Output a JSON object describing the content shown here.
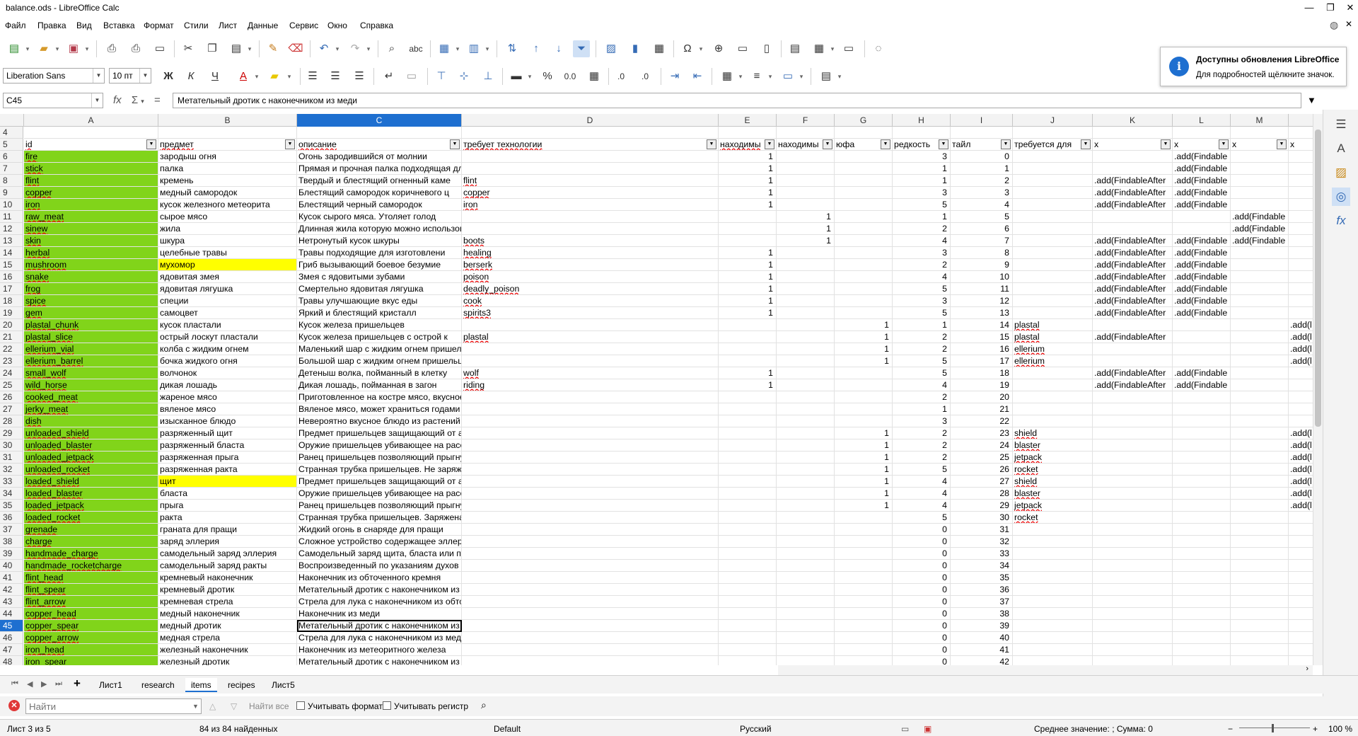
{
  "window": {
    "title": "balance.ods - LibreOffice Calc"
  },
  "menu": [
    "Файл",
    "Правка",
    "Вид",
    "Вставка",
    "Формат",
    "Стили",
    "Лист",
    "Данные",
    "Сервис",
    "Окно",
    "Справка"
  ],
  "toolbar2": {
    "font_name": "Liberation Sans",
    "font_size": "10 пт"
  },
  "formula": {
    "cell_ref": "C45",
    "content": "Метательный дротик с наконечником из меди"
  },
  "notification": {
    "title": "Доступны обновления LibreOffice",
    "text": "Для подробностей щёлкните значок."
  },
  "columns": [
    "A",
    "B",
    "C",
    "D",
    "E",
    "F",
    "G",
    "H",
    "I",
    "J",
    "K",
    "L",
    "M"
  ],
  "header_row": {
    "row": "5",
    "cells": [
      "id",
      "предмет",
      "описание",
      "требует технологии",
      "находимы",
      "находимы",
      "юфа",
      "редкость",
      "тайл",
      "требуется для",
      "x",
      "x",
      "x",
      "x"
    ]
  },
  "rows": [
    {
      "r": "4",
      "a": "",
      "b": "",
      "c": "",
      "d": "",
      "e": "",
      "f": "",
      "g": "",
      "h": "",
      "i": "",
      "j": "",
      "k": "",
      "l": "",
      "m": "",
      "n": ""
    },
    {
      "r": "6",
      "a": "fire",
      "b": "зародыш огня",
      "c": "Огонь зародившийся от молнии",
      "d": "",
      "e": "1",
      "f": "",
      "g": "",
      "h": "3",
      "i": "0",
      "j": "",
      "k": "",
      "l": ".add(Findable",
      "m": "",
      "n": ""
    },
    {
      "r": "7",
      "a": "stick",
      "b": "палка",
      "c": "Прямая и прочная палка подходящая для копья",
      "d": "",
      "e": "1",
      "f": "",
      "g": "",
      "h": "1",
      "i": "1",
      "j": "",
      "k": "",
      ".l": "",
      "l": ".add(Findable",
      "m": "",
      "n": ""
    },
    {
      "r": "8",
      "a": "flint",
      "b": "кремень",
      "c": "Твердый и блестящий огненный каме",
      "d": "flint",
      "e": "1",
      "f": "",
      "g": "",
      "h": "1",
      "i": "2",
      "j": "",
      "k": ".add(FindableAfter",
      ".l": "",
      "l": ".add(Findable",
      "m": "",
      "n": ""
    },
    {
      "r": "9",
      "a": "copper",
      "b": "медный самородок",
      "c": "Блестящий самородок коричневого ц",
      "d": "copper",
      "e": "1",
      "f": "",
      "g": "",
      "h": "3",
      "i": "3",
      "j": "",
      "k": ".add(FindableAfter",
      "l": ".add(Findable",
      "m": "",
      "n": ""
    },
    {
      "r": "10",
      "a": "iron",
      "b": "кусок железного метеорита",
      "c": "Блестящий черный самородок",
      "d": "iron",
      "e": "1",
      "f": "",
      "g": "",
      "h": "5",
      "i": "4",
      "j": "",
      "k": ".add(FindableAfter",
      "l": ".add(Findable",
      "m": "",
      "n": ""
    },
    {
      "r": "11",
      "a": "raw_meat",
      "b": "сырое мясо",
      "c": "Кусок сырого мяса. Утоляет голод",
      "d": "",
      "e": "",
      "f": "1",
      "g": "",
      "h": "1",
      "i": "5",
      "j": "",
      "k": "",
      "l": "",
      "m": ".add(Findable",
      "n": ""
    },
    {
      "r": "12",
      "a": "sinew",
      "b": "жила",
      "c": "Длинная жила которую можно использовать для создания вещей",
      "d": "",
      "e": "",
      "f": "1",
      "g": "",
      "h": "2",
      "i": "6",
      "j": "",
      "k": "",
      "l": "",
      "m": ".add(Findable",
      "n": ""
    },
    {
      "r": "13",
      "a": "skin",
      "b": "шкура",
      "c": "Нетронутый кусок шкуры",
      "d": "boots",
      "e": "",
      "f": "1",
      "g": "",
      "h": "4",
      "i": "7",
      "j": "",
      "k": ".add(FindableAfter",
      "l": ".add(Findable",
      "m": ".add(Findable",
      "n": ""
    },
    {
      "r": "14",
      "a": "herbal",
      "b": "целебные травы",
      "c": "Травы подходящие для изготовлени",
      "d": "healing",
      "e": "1",
      "f": "",
      "g": "",
      "h": "3",
      "i": "8",
      "j": "",
      "k": ".add(FindableAfter",
      "l": ".add(Findable",
      "m": "",
      "n": ""
    },
    {
      "r": "15",
      "a": "mushroom",
      "b": "мухомор",
      "c": "Гриб вызывающий боевое безумие",
      "d": "berserk",
      "e": "1",
      "f": "",
      "g": "",
      "h": "2",
      "i": "9",
      "j": "",
      "k": ".add(FindableAfter",
      "l": ".add(Findable",
      "m": "",
      "n": ""
    },
    {
      "r": "16",
      "a": "snake",
      "b": "ядовитая змея",
      "c": "Змея с ядовитыми зубами",
      "d": "poison",
      "e": "1",
      "f": "",
      "g": "",
      "h": "4",
      "i": "10",
      "j": "",
      "k": ".add(FindableAfter",
      "l": ".add(Findable",
      "m": "",
      "n": ""
    },
    {
      "r": "17",
      "a": "frog",
      "b": "ядовитая лягушка",
      "c": "Смертельно ядовитая лягушка",
      "d": "deadly_poison",
      "e": "1",
      "f": "",
      "g": "",
      "h": "5",
      "i": "11",
      "j": "",
      "k": ".add(FindableAfter",
      "l": ".add(Findable",
      "m": "",
      "n": ""
    },
    {
      "r": "18",
      "a": "spice",
      "b": "специи",
      "c": "Травы улучшающие вкус еды",
      "d": "cook",
      "e": "1",
      "f": "",
      "g": "",
      "h": "3",
      "i": "12",
      "j": "",
      "k": ".add(FindableAfter",
      "l": ".add(Findable",
      "m": "",
      "n": ""
    },
    {
      "r": "19",
      "a": "gem",
      "b": "самоцвет",
      "c": "Яркий и блестящий кристалл",
      "d": "spirits3",
      "e": "1",
      "f": "",
      "g": "",
      "h": "5",
      "i": "13",
      "j": "",
      "k": ".add(FindableAfter",
      "l": ".add(Findable",
      "m": "",
      "n": ""
    },
    {
      "r": "20",
      "a": "plastal_chunk",
      "b": "кусок пластали",
      "c": "Кусок железа пришельцев",
      "d": "",
      "e": "",
      "f": "",
      "g": "1",
      "h": "1",
      "i": "14",
      "j": "plastal",
      "k": "",
      "l": "",
      "m": "",
      "n": ".add(l"
    },
    {
      "r": "21",
      "a": "plastal_slice",
      "b": "острый лоскут пластали",
      "c": "Кусок железа пришельцев с острой к",
      "d": "plastal",
      "e": "",
      "f": "",
      "g": "1",
      "h": "2",
      "i": "15",
      "j": "plastal",
      "k": ".add(FindableAfter",
      "l": "",
      "m": "",
      "n": ".add(l"
    },
    {
      "r": "22",
      "a": "ellerium_vial",
      "b": "колба с жидким огнем",
      "c": "Маленький шар с жидким огнем пришельцев",
      "d": "",
      "e": "",
      "f": "",
      "g": "1",
      "h": "2",
      "i": "16",
      "j": "ellerium",
      "k": "",
      "l": "",
      "m": "",
      "n": ".add(l"
    },
    {
      "r": "23",
      "a": "ellerium_barrel",
      "b": "бочка жидкого огня",
      "c": "Большой шар с жидким огнем пришельцев. Выглядит опасным.",
      "d": "",
      "e": "",
      "f": "",
      "g": "1",
      "h": "5",
      "i": "17",
      "j": "ellerium",
      "k": "",
      "l": "",
      "m": "",
      "n": ".add(l"
    },
    {
      "r": "24",
      "a": "small_wolf",
      "b": "волчонок",
      "c": "Детеныш волка, пойманный в клетку",
      "d": "wolf",
      "e": "1",
      "f": "",
      "g": "",
      "h": "5",
      "i": "18",
      "j": "",
      "k": ".add(FindableAfter",
      "l": ".add(Findable",
      "m": "",
      "n": ""
    },
    {
      "r": "25",
      "a": "wild_horse",
      "b": "дикая лошадь",
      "c": "Дикая лошадь, пойманная в загон",
      "d": "riding",
      "e": "1",
      "f": "",
      "g": "",
      "h": "4",
      "i": "19",
      "j": "",
      "k": ".add(FindableAfter",
      "l": ".add(Findable",
      "m": "",
      "n": ""
    },
    {
      "r": "26",
      "a": "cooked_meat",
      "b": "жареное мясо",
      "c": "Приготовленное на костре мясо, вкусное и питательное",
      "d": "",
      "e": "",
      "f": "",
      "g": "",
      "h": "2",
      "i": "20",
      "j": "",
      "k": "",
      "l": "",
      "m": "",
      "n": ""
    },
    {
      "r": "27",
      "a": "jerky_meat",
      "b": "вяленое мясо",
      "c": "Вяленое мясо, может храниться годами",
      "d": "",
      "e": "",
      "f": "",
      "g": "",
      "h": "1",
      "i": "21",
      "j": "",
      "k": "",
      "l": "",
      "m": "",
      "n": ""
    },
    {
      "r": "28",
      "a": "dish",
      "b": "изысканное блюдо",
      "c": "Невероятно вкусное блюдо из растений и мяса",
      "d": "",
      "e": "",
      "f": "",
      "g": "",
      "h": "3",
      "i": "22",
      "j": "",
      "k": "",
      "l": "",
      "m": "",
      "n": ""
    },
    {
      "r": "29",
      "a": "unloaded_shield",
      "b": "разряженный щит",
      "c": "Предмет пришельцев защищающий от атак. Этот выглядит разряженным",
      "d": "",
      "e": "",
      "f": "",
      "g": "1",
      "h": "2",
      "i": "23",
      "j": "shield",
      "k": "",
      "l": "",
      "m": "",
      "n": ".add(l"
    },
    {
      "r": "30",
      "a": "unloaded_blaster",
      "b": "разряженный бласта",
      "c": "Оружие пришельцев убивающее на расстоянии. Это - выглядит разряженным",
      "d": "",
      "e": "",
      "f": "",
      "g": "1",
      "h": "2",
      "i": "24",
      "j": "blaster",
      "k": "",
      "l": "",
      "m": "",
      "n": ".add(l"
    },
    {
      "r": "31",
      "a": "unloaded_jetpack",
      "b": "разряженная прыга",
      "c": "Ранец пришельцев позволяющий прыгнуть на любое расстояние. Этот выглядит разряженным",
      "d": "",
      "e": "",
      "f": "",
      "g": "1",
      "h": "2",
      "i": "25",
      "j": "jetpack",
      "k": "",
      "l": "",
      "m": "",
      "n": ".add(l"
    },
    {
      "r": "32",
      "a": "unloaded_rocket",
      "b": "разряженная ракта",
      "c": "Странная трубка пришельцев. Не заряжена",
      "d": "",
      "e": "",
      "f": "",
      "g": "1",
      "h": "5",
      "i": "26",
      "j": "rocket",
      "k": "",
      "l": "",
      "m": "",
      "n": ".add(l"
    },
    {
      "r": "33",
      "a": "loaded_shield",
      "b": "щит",
      "c": "Предмет пришельцев защищающий от атак. Этот - заряжен.",
      "d": "",
      "e": "",
      "f": "",
      "g": "1",
      "h": "4",
      "i": "27",
      "j": "shield",
      "k": "",
      "l": "",
      "m": "",
      "n": ".add(l"
    },
    {
      "r": "34",
      "a": "loaded_blaster",
      "b": "бласта",
      "c": "Оружие пришельцев убивающее на расстоянии. Это - заряжено.",
      "d": "",
      "e": "",
      "f": "",
      "g": "1",
      "h": "4",
      "i": "28",
      "j": "blaster",
      "k": "",
      "l": "",
      "m": "",
      "n": ".add(l"
    },
    {
      "r": "35",
      "a": "loaded_jetpack",
      "b": "прыга",
      "c": "Ранец пришельцев позволяющий прыгнуть на любое расстояние. Этот - заряжен.",
      "d": "",
      "e": "",
      "f": "",
      "g": "1",
      "h": "4",
      "i": "29",
      "j": "jetpack",
      "k": "",
      "l": "",
      "m": "",
      "n": ".add(l"
    },
    {
      "r": "36",
      "a": "loaded_rocket",
      "b": "ракта",
      "c": "Странная трубка пришельцев. Заряжена и может сбить Юфу.",
      "d": "",
      "e": "",
      "f": "",
      "g": "",
      "h": "5",
      "i": "30",
      "j": "rocket",
      "k": "",
      "l": "",
      "m": "",
      "n": ""
    },
    {
      "r": "37",
      "a": "grenade",
      "b": "граната для пращи",
      "c": "Жидкий огонь в снаряде для пращи",
      "d": "",
      "e": "",
      "f": "",
      "g": "",
      "h": "0",
      "i": "31",
      "j": "",
      "k": "",
      "l": "",
      "m": "",
      "n": ""
    },
    {
      "r": "38",
      "a": "charge",
      "b": "заряд эллерия",
      "c": "Сложное устройство содержащее эллерий и пригодное для заряда щита, бласта или прыги",
      "d": "",
      "e": "",
      "f": "",
      "g": "",
      "h": "0",
      "i": "32",
      "j": "",
      "k": "",
      "l": "",
      "m": "",
      "n": ""
    },
    {
      "r": "39",
      "a": "handmade_charge",
      "b": "самодельный заряд эллерия",
      "c": "Самодельный заряд щита, бласта или прыги",
      "d": "",
      "e": "",
      "f": "",
      "g": "",
      "h": "0",
      "i": "33",
      "j": "",
      "k": "",
      "l": "",
      "m": "",
      "n": ""
    },
    {
      "r": "40",
      "a": "handmade_rocketcharge",
      "b": "самодельный заряд ракты",
      "c": "Воспроизведенный по указаниям духов снаряд для ракты. Может уничтожить Юфу.",
      "d": "",
      "e": "",
      "f": "",
      "g": "",
      "h": "0",
      "i": "34",
      "j": "",
      "k": "",
      "l": "",
      "m": "",
      "n": ""
    },
    {
      "r": "41",
      "a": "flint_head",
      "b": "кремневый наконечник",
      "c": "Наконечник из обточенного кремня",
      "d": "",
      "e": "",
      "f": "",
      "g": "",
      "h": "0",
      "i": "35",
      "j": "",
      "k": "",
      "l": "",
      "m": "",
      "n": ""
    },
    {
      "r": "42",
      "a": "flint_spear",
      "b": "кремневый дротик",
      "c": "Метательный дротик с наконечником из обточенного кремня",
      "d": "",
      "e": "",
      "f": "",
      "g": "",
      "h": "0",
      "i": "36",
      "j": "",
      "k": "",
      "l": "",
      "m": "",
      "n": ""
    },
    {
      "r": "43",
      "a": "flint_arrow",
      "b": "кремневая стрела",
      "c": "Стрела для лука с наконечником из обточенного кремня",
      "d": "",
      "e": "",
      "f": "",
      "g": "",
      "h": "0",
      "i": "37",
      "j": "",
      "k": "",
      "l": "",
      "m": "",
      "n": ""
    },
    {
      "r": "44",
      "a": "copper_head",
      "b": "медный наконечник",
      "c": "Наконечник из меди",
      "d": "",
      "e": "",
      "f": "",
      "g": "",
      "h": "0",
      "i": "38",
      "j": "",
      "k": "",
      "l": "",
      "m": "",
      "n": ""
    },
    {
      "r": "45",
      "a": "copper_spear",
      "b": "медный дротик",
      "c": "Метательный дротик с наконечником из меди",
      "d": "",
      "e": "",
      "f": "",
      "g": "",
      "h": "0",
      "i": "39",
      "j": "",
      "k": "",
      "l": "",
      "m": "",
      "n": ""
    },
    {
      "r": "46",
      "a": "copper_arrow",
      "b": "медная стрела",
      "c": "Стрела для лука с наконечником из меди",
      "d": "",
      "e": "",
      "f": "",
      "g": "",
      "h": "0",
      "i": "40",
      "j": "",
      "k": "",
      "l": "",
      "m": "",
      "n": ""
    },
    {
      "r": "47",
      "a": "iron_head",
      "b": "железный наконечник",
      "c": "Наконечник из метеоритного железа",
      "d": "",
      "e": "",
      "f": "",
      "g": "",
      "h": "0",
      "i": "41",
      "j": "",
      "k": "",
      "l": "",
      "m": "",
      "n": ""
    },
    {
      "r": "48",
      "a": "iron_spear",
      "b": "железный дротик",
      "c": "Метательный дротик с наконечником из метеоритного железа",
      "d": "",
      "e": "",
      "f": "",
      "g": "",
      "h": "0",
      "i": "42",
      "j": "",
      "k": "",
      "l": "",
      "m": "",
      "n": ""
    }
  ],
  "sheet_tabs": [
    "Лист1",
    "research",
    "items",
    "recipes",
    "Лист5"
  ],
  "active_tab": "items",
  "findbar": {
    "placeholder": "Найти",
    "find_all": "Найти все",
    "match_format": "Учитывать формат",
    "match_case": "Учитывать регистр"
  },
  "status": {
    "sheet": "Лист 3 из 5",
    "found": "84 из 84 найденных",
    "style": "Default",
    "language": "Русский",
    "summary": "Среднее значение: ; Сумма: 0",
    "zoom": "100 %"
  },
  "colors": {
    "green_fill": "#81d41a",
    "yellow_fill": "#ffff00",
    "selection": "#1e6fd0"
  }
}
